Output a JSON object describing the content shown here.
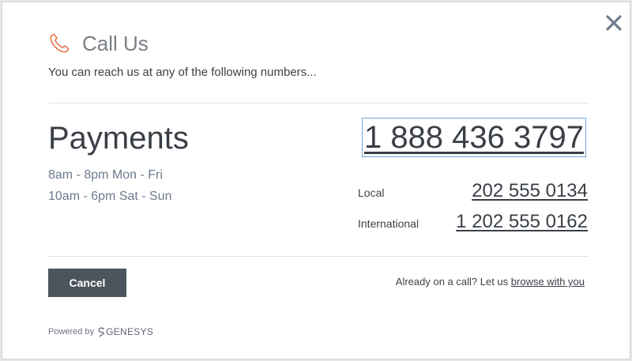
{
  "dialog": {
    "title": "Call Us",
    "subtitle": "You can reach us at any of the following numbers...",
    "close_icon": "close-icon",
    "phone_icon": "phone-icon"
  },
  "department": {
    "name": "Payments",
    "hours": [
      "8am - 8pm Mon - Fri",
      "10am - 6pm Sat - Sun"
    ],
    "main_number": "1 888 436 3797",
    "numbers": [
      {
        "label": "Local",
        "number": "202 555 0134"
      },
      {
        "label": "International",
        "number": "1 202 555 0162"
      }
    ]
  },
  "footer": {
    "cancel_label": "Cancel",
    "cobrowse_text": "Already on a call? Let us",
    "cobrowse_link": "browse with you",
    "powered_by": "Powered by",
    "brand": "GENESYS"
  },
  "colors": {
    "accent": "#e8734a",
    "button": "#4c555e",
    "text": "#3a3f46",
    "hours": "#6d7a8c"
  }
}
